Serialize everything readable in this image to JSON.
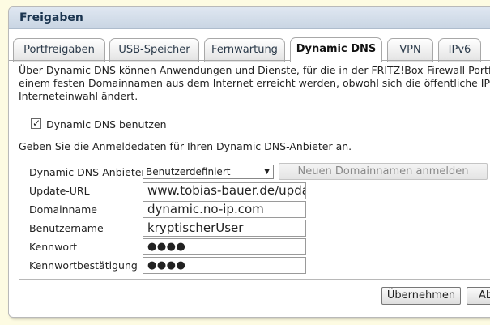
{
  "window": {
    "title": "Freigaben"
  },
  "tabs": [
    {
      "label": "Portfreigaben"
    },
    {
      "label": "USB-Speicher"
    },
    {
      "label": "Fernwartung"
    },
    {
      "label": "Dynamic DNS"
    },
    {
      "label": "VPN"
    },
    {
      "label": "IPv6"
    }
  ],
  "active_tab": "Dynamic DNS",
  "intro": {
    "line1": "Über Dynamic DNS können Anwendungen und Dienste, für die in der FRITZ!Box-Firewall Portfreigaben",
    "line2": "einem festen Domainnamen aus dem Internet erreicht werden, obwohl sich die öffentliche IP-Adresse",
    "line3": "Interneteinwahl ändert."
  },
  "enable_checkbox": {
    "label": "Dynamic DNS benutzen",
    "checked": true
  },
  "instruction": "Geben Sie die Anmeldedaten für Ihren Dynamic DNS-Anbieter an.",
  "form": {
    "provider_label": "Dynamic DNS-Anbieter",
    "provider_value": "Benutzerdefiniert",
    "register_button": "Neuen Domainnamen anmelden",
    "update_url_label": "Update-URL",
    "update_url_value": "www.tobias-bauer.de/updat",
    "domain_label": "Domainname",
    "domain_value": "dynamic.no-ip.com",
    "user_label": "Benutzername",
    "user_value": "kryptischerUser",
    "password_label": "Kennwort",
    "password_value": "●●●●",
    "password_confirm_label": "Kennwortbestätigung",
    "password_confirm_value": "●●●●"
  },
  "buttons": {
    "apply": "Übernehmen",
    "cancel": "Ab"
  }
}
